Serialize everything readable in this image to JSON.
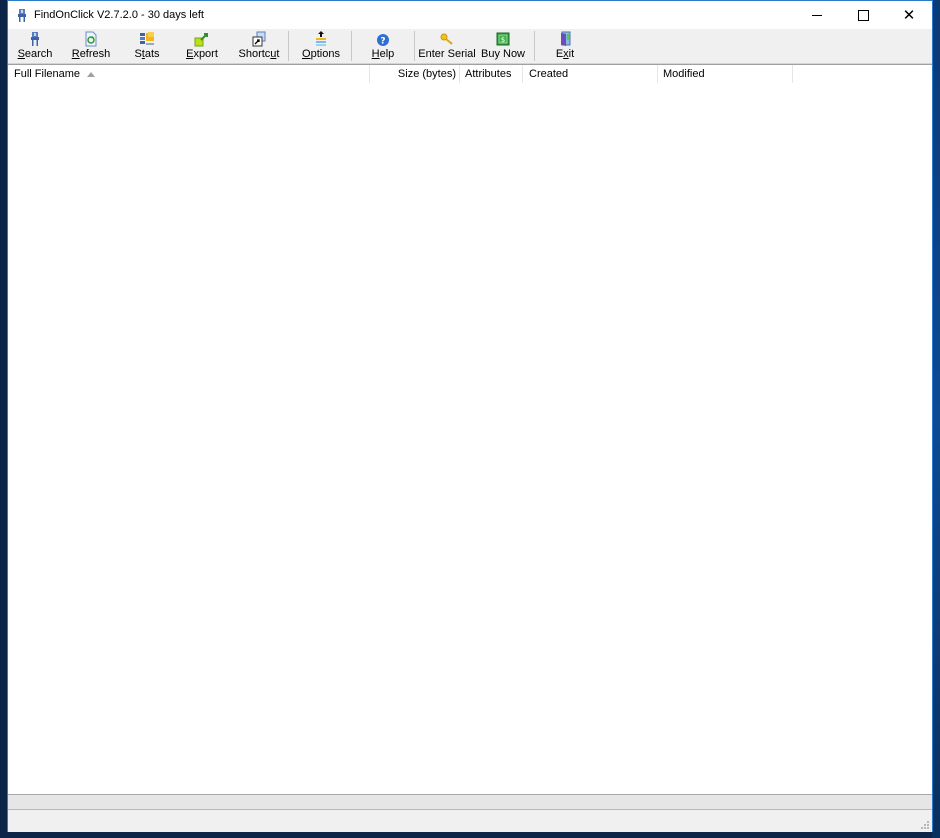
{
  "window": {
    "title": "FindOnClick V2.7.2.0 - 30 days left",
    "controls": {
      "minimize": "minimize",
      "maximize": "maximize",
      "close": "close"
    }
  },
  "toolbar": {
    "buttons": [
      {
        "id": "search",
        "label": "Search",
        "mnemonic": "S",
        "icon": "search-icon"
      },
      {
        "id": "refresh",
        "label": "Refresh",
        "mnemonic": "R",
        "icon": "refresh-icon"
      },
      {
        "id": "stats",
        "label": "Stats",
        "mnemonic": "t",
        "icon": "stats-icon"
      },
      {
        "id": "export",
        "label": "Export",
        "mnemonic": "E",
        "icon": "export-icon"
      },
      {
        "id": "shortcut",
        "label": "Shortcut",
        "mnemonic": "u",
        "icon": "shortcut-icon"
      },
      {
        "id": "options",
        "label": "Options",
        "mnemonic": "O",
        "icon": "options-icon"
      },
      {
        "id": "help",
        "label": "Help",
        "mnemonic": "H",
        "icon": "help-icon"
      },
      {
        "id": "enter-serial",
        "label": "Enter Serial",
        "mnemonic": "",
        "icon": "key-icon"
      },
      {
        "id": "buy-now",
        "label": "Buy Now",
        "mnemonic": "",
        "icon": "dollar-icon"
      },
      {
        "id": "exit",
        "label": "Exit",
        "mnemonic": "x",
        "icon": "exit-door-icon"
      }
    ]
  },
  "list": {
    "columns": [
      {
        "id": "full-filename",
        "label": "Full Filename",
        "sorted": "ascending"
      },
      {
        "id": "size",
        "label": "Size (bytes)"
      },
      {
        "id": "attributes",
        "label": "Attributes"
      },
      {
        "id": "created",
        "label": "Created"
      },
      {
        "id": "modified",
        "label": "Modified"
      }
    ],
    "rows": []
  },
  "statusbar": {
    "text": ""
  }
}
